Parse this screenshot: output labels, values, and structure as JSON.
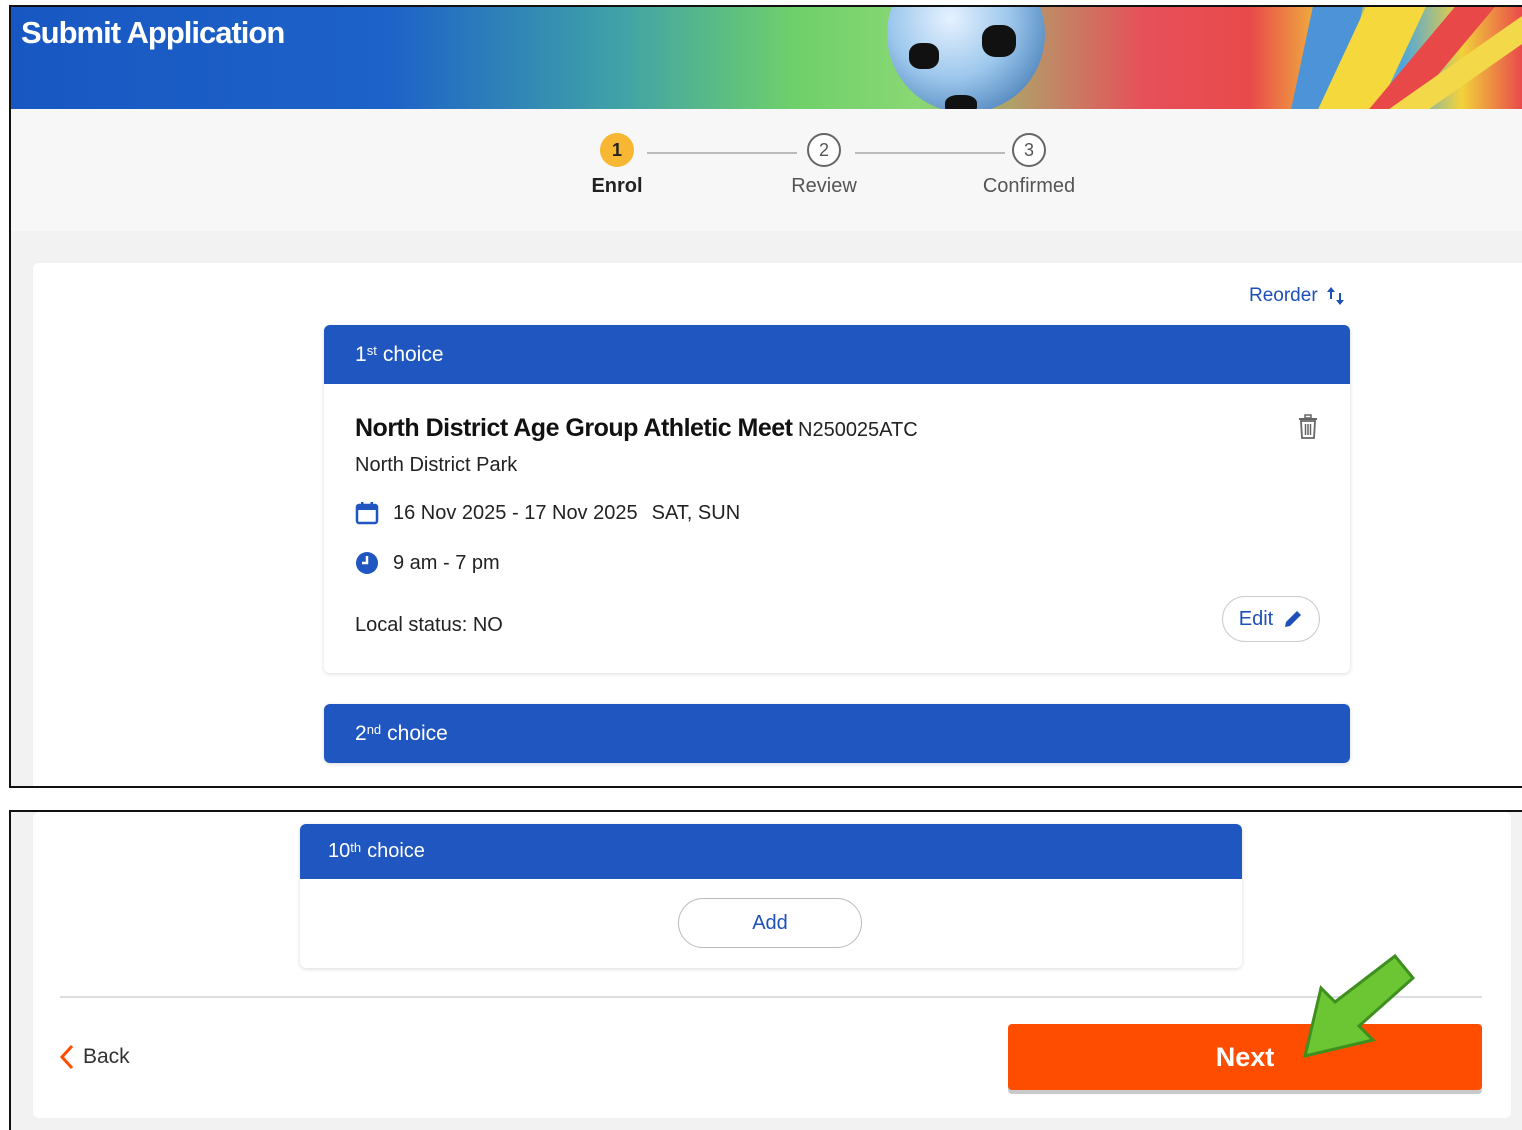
{
  "header": {
    "title": "Submit Application"
  },
  "stepper": {
    "steps": [
      {
        "number": "1",
        "label": "Enrol"
      },
      {
        "number": "2",
        "label": "Review"
      },
      {
        "number": "3",
        "label": "Confirmed"
      }
    ],
    "active_step": 1
  },
  "reorder_label": "Reorder",
  "choices": [
    {
      "ordinal_num": "1",
      "ordinal_suffix": "st",
      "label": "choice",
      "event": {
        "title": "North District Age Group Athletic Meet",
        "code": "N250025ATC",
        "venue": "North District Park",
        "date_range": "16 Nov 2025 - 17 Nov 2025",
        "days": "SAT, SUN",
        "time": "9 am - 7 pm",
        "local_status": "Local status: NO"
      },
      "edit_label": "Edit"
    },
    {
      "ordinal_num": "2",
      "ordinal_suffix": "nd",
      "label": "choice"
    },
    {
      "ordinal_num": "10",
      "ordinal_suffix": "th",
      "label": "choice",
      "add_label": "Add"
    }
  ],
  "footer": {
    "back_label": "Back",
    "next_label": "Next"
  },
  "colors": {
    "primary_blue": "#1f56bf",
    "next_orange": "#ff4d00",
    "active_step": "#f7b733",
    "annotation_arrow": "#6cc533"
  },
  "icons": [
    "trash-icon",
    "calendar-icon",
    "clock-icon",
    "pencil-icon",
    "reorder-arrows-icon",
    "chevron-left-icon",
    "green-pointer-arrow-icon"
  ]
}
